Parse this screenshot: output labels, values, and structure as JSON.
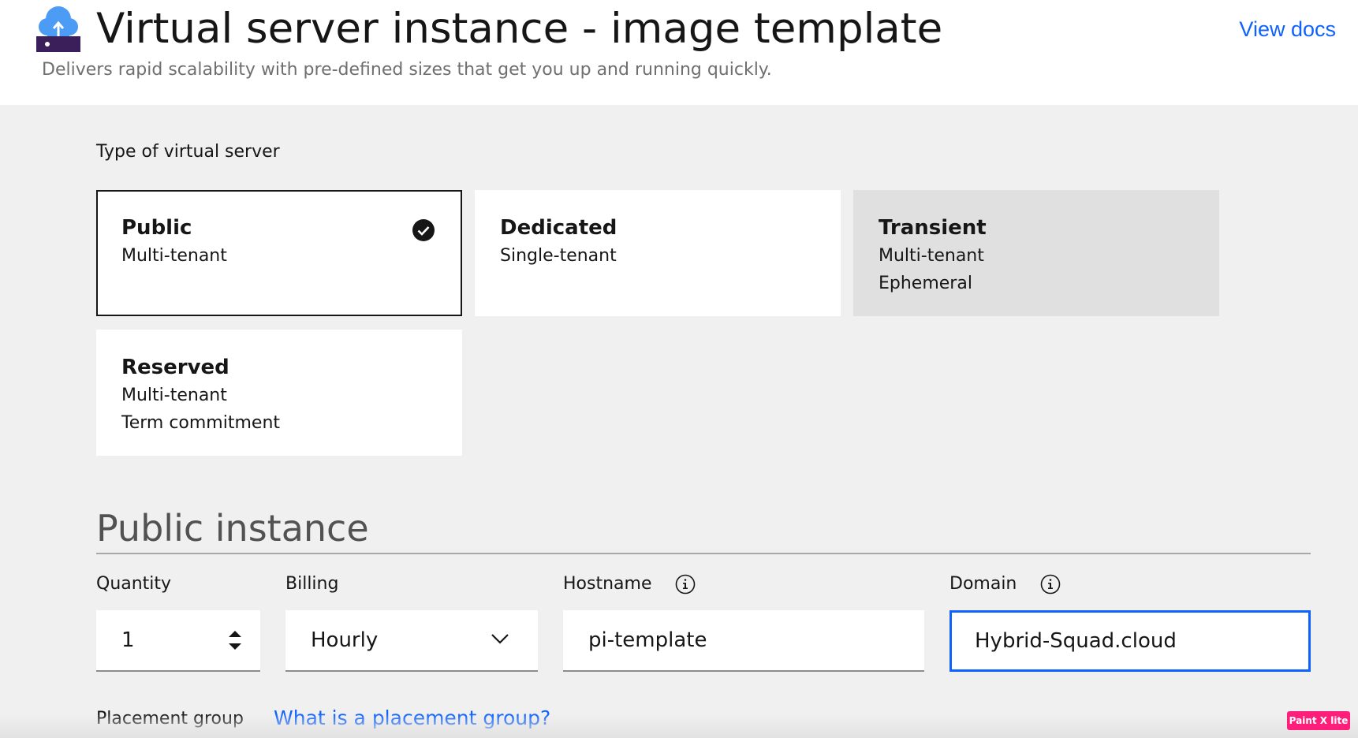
{
  "header": {
    "title": "Virtual server instance - image template",
    "subtitle": "Delivers rapid scalability with pre-defined sizes that get you up and running quickly.",
    "view_docs": "View docs",
    "logo_icon": "cloud-upload-server-icon"
  },
  "server_type": {
    "label": "Type of virtual server",
    "options": [
      {
        "title": "Public",
        "lines": [
          "Multi-tenant"
        ],
        "selected": true,
        "disabled": false
      },
      {
        "title": "Dedicated",
        "lines": [
          "Single-tenant"
        ],
        "selected": false,
        "disabled": false
      },
      {
        "title": "Transient",
        "lines": [
          "Multi-tenant",
          "Ephemeral"
        ],
        "selected": false,
        "disabled": true
      },
      {
        "title": "Reserved",
        "lines": [
          "Multi-tenant",
          "Term commitment"
        ],
        "selected": false,
        "disabled": false
      }
    ]
  },
  "instance": {
    "title": "Public instance",
    "quantity": {
      "label": "Quantity",
      "value": "1"
    },
    "billing": {
      "label": "Billing",
      "value": "Hourly"
    },
    "hostname": {
      "label": "Hostname",
      "value": "pi-template",
      "info_icon": "info-icon"
    },
    "domain": {
      "label": "Domain",
      "value": "Hybrid-Squad.cloud",
      "info_icon": "info-icon"
    },
    "placement_group": {
      "label": "Placement group",
      "link": "What is a placement group?"
    }
  },
  "watermark": "Paint X lite",
  "colors": {
    "accent": "#0f62fe",
    "selected_border": "#161616",
    "disabled_tile": "#e0e0e0",
    "page_bg": "#f0f0f0"
  }
}
